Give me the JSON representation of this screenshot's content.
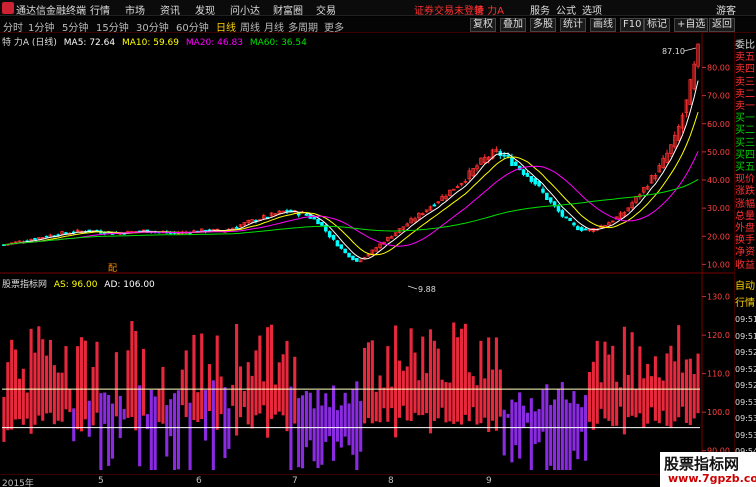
{
  "titlebar": {
    "app_name": "通达信金融终端",
    "menus": [
      "行情",
      "市场",
      "资讯",
      "发现",
      "问小达",
      "财富圈",
      "交易"
    ],
    "notice": "证券交易未登录",
    "stock_name": "特 力A",
    "right_menus": [
      "服务",
      "公式",
      "选项",
      "游客"
    ]
  },
  "toolbar": {
    "periods": [
      "分时",
      "1分钟",
      "5分钟",
      "15分钟",
      "30分钟",
      "60分钟",
      "日线",
      "周线",
      "月线",
      "多周期",
      "更多"
    ],
    "active_period": "日线",
    "buttons": [
      "复权",
      "叠加",
      "多股",
      "统计",
      "画线",
      "F10",
      "标记",
      "+自选",
      "返回"
    ]
  },
  "main_chart": {
    "stock_label": "特 力A (日线)",
    "ma": [
      {
        "label": "MA5: 72.64",
        "color": "#ffffff"
      },
      {
        "label": "MA10: 59.69",
        "color": "#ffff00"
      },
      {
        "label": "MA20: 46.83",
        "color": "#ff00ff"
      },
      {
        "label": "MA60: 36.54",
        "color": "#00e000"
      }
    ],
    "price_ticks": [
      "80.00",
      "70.00",
      "60.00",
      "50.00",
      "40.00",
      "30.00",
      "20.00",
      "10.00"
    ],
    "high_label": "87.10",
    "low_label": "9.88",
    "marker": "配"
  },
  "indicator": {
    "name": "股票指标网",
    "as_label": "AS: 96.00",
    "ad_label": "AD: 106.00",
    "ticks": [
      "130.0",
      "120.0",
      "110.0",
      "100.0",
      "90.00"
    ],
    "upper_line": 106,
    "lower_line": 96
  },
  "side_panel": {
    "top_items": [
      "委比",
      "卖五",
      "卖四",
      "卖三",
      "卖二",
      "卖一",
      "买一",
      "买二",
      "买三",
      "买四",
      "买五",
      "现价",
      "涨跌",
      "涨幅",
      "总量",
      "外盘",
      "换手",
      "净资",
      "收益"
    ],
    "bottom_items": [
      "自动",
      "行情",
      "09:51",
      "09:51",
      "09:52",
      "09:52",
      "09:52",
      "09:53",
      "09:53",
      "09:53",
      "09:54",
      "09:55"
    ]
  },
  "time_axis": {
    "labels": [
      "2015年",
      "5",
      "6",
      "7",
      "8",
      "9"
    ]
  },
  "watermark": {
    "line1": "股票指标网",
    "line2": "www.7gpzb.com"
  },
  "colors": {
    "up": "#ff3030",
    "down": "#00ffff",
    "indicator_up": "#e8283c",
    "indicator_down": "#8a2be2"
  }
}
